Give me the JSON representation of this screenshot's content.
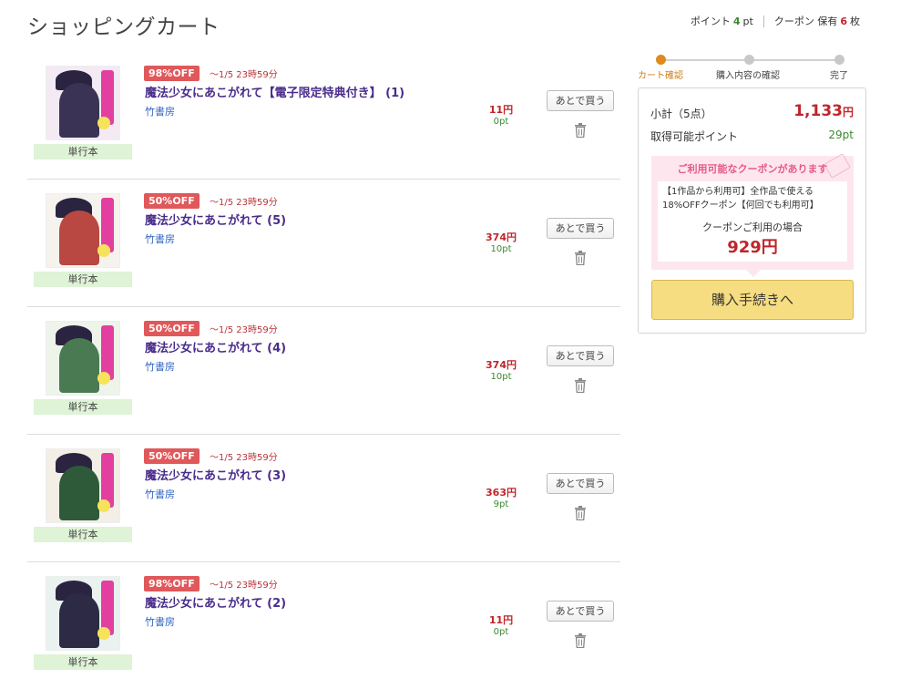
{
  "page": {
    "title": "ショッピングカート"
  },
  "header": {
    "points_label": "ポイント",
    "points_value": "4",
    "points_unit": "pt",
    "coupon_label": "クーポン 保有",
    "coupon_value": "6",
    "coupon_unit": "枚"
  },
  "colors": {
    "accent_red": "#c0252a",
    "accent_green": "#3a8a2e",
    "badge_red": "#e0585a",
    "title_purple": "#4a2c8a",
    "purchase_yellow": "#f7dd82",
    "step_active": "#e08a1e"
  },
  "cart": {
    "later_label": "あとで買う",
    "items": [
      {
        "discount": "98%OFF",
        "deadline": "～1/5 23時59分",
        "title": "魔法少女にあこがれて【電子限定特典付き】 (1)",
        "publisher": "竹書房",
        "price": "11円",
        "points": "0pt",
        "format": "単行本",
        "cover_bg": "#f4eaf4",
        "cover_fig": "#3b3355"
      },
      {
        "discount": "50%OFF",
        "deadline": "～1/5 23時59分",
        "title": "魔法少女にあこがれて (5)",
        "publisher": "竹書房",
        "price": "374円",
        "points": "10pt",
        "format": "単行本",
        "cover_bg": "#f6f3ee",
        "cover_fig": "#b94842"
      },
      {
        "discount": "50%OFF",
        "deadline": "～1/5 23時59分",
        "title": "魔法少女にあこがれて (4)",
        "publisher": "竹書房",
        "price": "374円",
        "points": "10pt",
        "format": "単行本",
        "cover_bg": "#eef4ea",
        "cover_fig": "#4a7a52"
      },
      {
        "discount": "50%OFF",
        "deadline": "～1/5 23時59分",
        "title": "魔法少女にあこがれて (3)",
        "publisher": "竹書房",
        "price": "363円",
        "points": "9pt",
        "format": "単行本",
        "cover_bg": "#f3eee6",
        "cover_fig": "#2f5a3a"
      },
      {
        "discount": "98%OFF",
        "deadline": "～1/5 23時59分",
        "title": "魔法少女にあこがれて (2)",
        "publisher": "竹書房",
        "price": "11円",
        "points": "0pt",
        "format": "単行本",
        "cover_bg": "#eaf2f0",
        "cover_fig": "#2c2a44"
      }
    ]
  },
  "steps": [
    {
      "label": "カート確認",
      "active": true
    },
    {
      "label": "購入内容の確認",
      "active": false
    },
    {
      "label": "完了",
      "active": false
    }
  ],
  "summary": {
    "subtotal_label": "小計（5点）",
    "subtotal_value": "1,133",
    "subtotal_unit": "円",
    "points_label": "取得可能ポイント",
    "points_value": "29pt",
    "coupon_heading": "ご利用可能なクーポンがあります",
    "coupon_desc": "【1作品から利用可】全作品で使える18%OFFクーポン【何回でも利用可】",
    "coupon_apply_label": "クーポンご利用の場合",
    "coupon_price": "929円",
    "purchase_label": "購入手続きへ"
  }
}
